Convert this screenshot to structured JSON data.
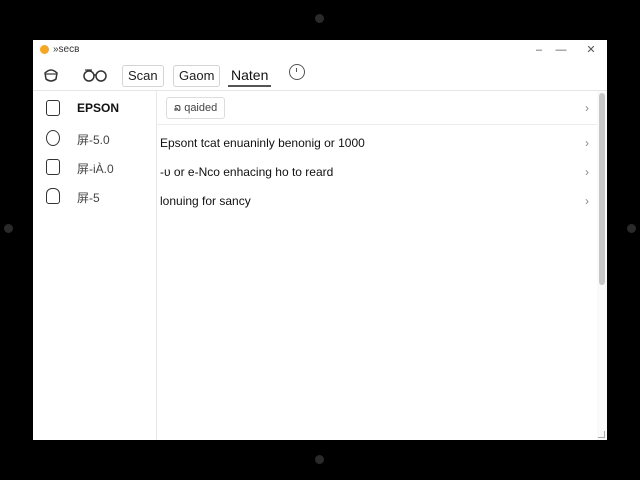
{
  "window": {
    "title": "»ѕесв",
    "minimize": "–",
    "maximize": "—",
    "close": "✕"
  },
  "toolbar": {
    "buttons": [
      "Scan",
      "Gaom"
    ],
    "active_tab": "Naten",
    "icons": [
      "cloud-icon",
      "glasses-icon",
      "clock-icon"
    ]
  },
  "sidebar": {
    "items": [
      {
        "label": "EPSON",
        "icon": "printer-icon"
      },
      {
        "label": "屏-5.0",
        "icon": "info-icon"
      },
      {
        "label": "屏-іÀ.0",
        "icon": "edit-icon"
      },
      {
        "label": "屏-5",
        "icon": "folder-icon"
      }
    ]
  },
  "content": {
    "filter_label": "ລ qaided",
    "rows": [
      {
        "text": "Epsont tcat enuaninly benonig or 1000"
      },
      {
        "text": "-υ or e-Nco enhacing ho to reard"
      },
      {
        "text": "lonuing for sancy"
      }
    ]
  },
  "chevron": "›",
  "colors": {
    "accent": "#f5a623",
    "background": "#000000",
    "window": "#ffffff"
  }
}
